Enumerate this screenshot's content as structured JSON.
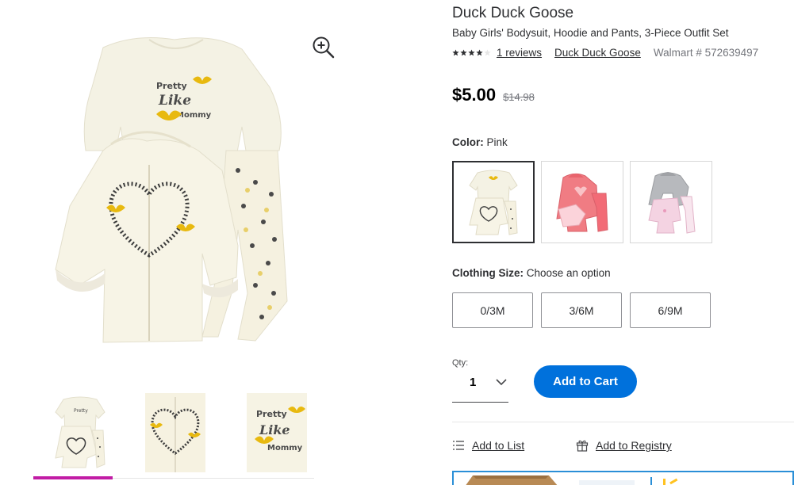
{
  "product": {
    "brand": "Duck Duck Goose",
    "name": "Baby Girls' Bodysuit, Hoodie and Pants, 3-Piece Outfit Set",
    "rating": 4,
    "rating_max": 5,
    "reviews_label": "1 reviews",
    "brand_link": "Duck Duck Goose",
    "sku": "Walmart # 572639497",
    "price": "$5.00",
    "was_price": "$14.98"
  },
  "color": {
    "label": "Color:",
    "value": "Pink",
    "swatches": [
      "cream-heart-outfit",
      "pink-coral-outfit",
      "pink-gray-outfit"
    ],
    "selected_index": 0
  },
  "size": {
    "label": "Clothing Size:",
    "value": "Choose an option",
    "options": [
      "0/3M",
      "3/6M",
      "6/9M"
    ]
  },
  "qty": {
    "label": "Qty:",
    "value": "1"
  },
  "actions": {
    "add_to_cart": "Add to Cart",
    "add_to_list": "Add to List",
    "add_to_registry": "Add to Registry"
  },
  "colors": {
    "accent_blue": "#0071dc",
    "active_thumb": "#c11ca5",
    "gold": "#e8b90f"
  },
  "icons": {
    "zoom": "zoom-in-icon",
    "list": "list-icon",
    "registry": "gift-icon"
  }
}
